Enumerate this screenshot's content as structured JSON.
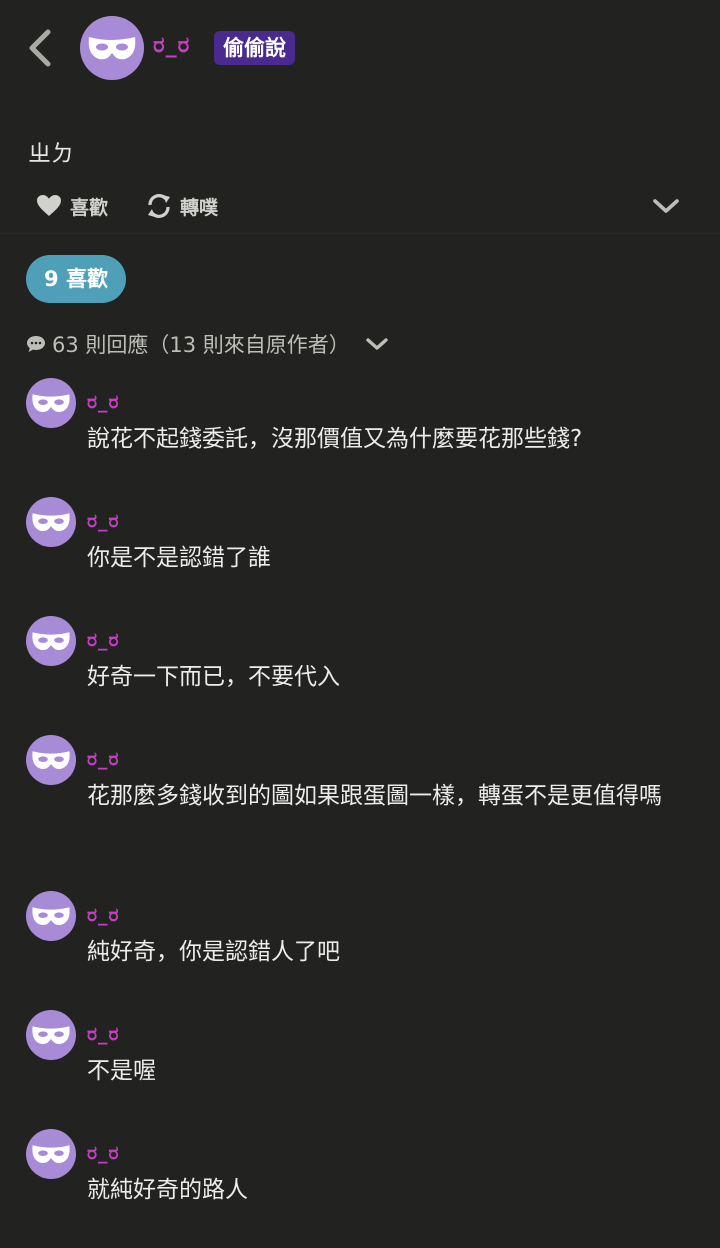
{
  "colors": {
    "background": "#222320",
    "username": "#c23fc2",
    "avatar": "#a78bd6",
    "tag": "#4a2a8f",
    "likes_pill": "#4f9fb9"
  },
  "header": {
    "back_icon": "chevron-left-icon",
    "avatar_icon": "mask-icon",
    "username": "ರ_ರ",
    "tag": "偷偷說"
  },
  "post": {
    "body": "ㄓㄉ"
  },
  "actions": {
    "like_label": "喜歡",
    "like_icon": "heart-icon",
    "repost_label": "轉噗",
    "repost_icon": "repost-icon",
    "expand_icon": "chevron-down-icon"
  },
  "likes": {
    "label": "9 喜歡"
  },
  "replies": {
    "icon": "speech-bubble-icon",
    "summary": "63 則回應（13 則來自原作者）",
    "toggle_icon": "chevron-down-icon"
  },
  "comments": [
    {
      "user": "ರ_ರ",
      "text": "說花不起錢委託，沒那價值又為什麼要花那些錢?"
    },
    {
      "user": "ರ_ರ",
      "text": "你是不是認錯了誰"
    },
    {
      "user": "ರ_ರ",
      "text": "好奇一下而已，不要代入"
    },
    {
      "user": "ರ_ರ",
      "text": "花那麼多錢收到的圖如果跟蛋圖一樣，轉蛋不是更值得嗎"
    },
    {
      "user": "ರ_ರ",
      "text": "純好奇，你是認錯人了吧"
    },
    {
      "user": "ರ_ರ",
      "text": "不是喔"
    },
    {
      "user": "ರ_ರ",
      "text": "就純好奇的路人"
    }
  ]
}
